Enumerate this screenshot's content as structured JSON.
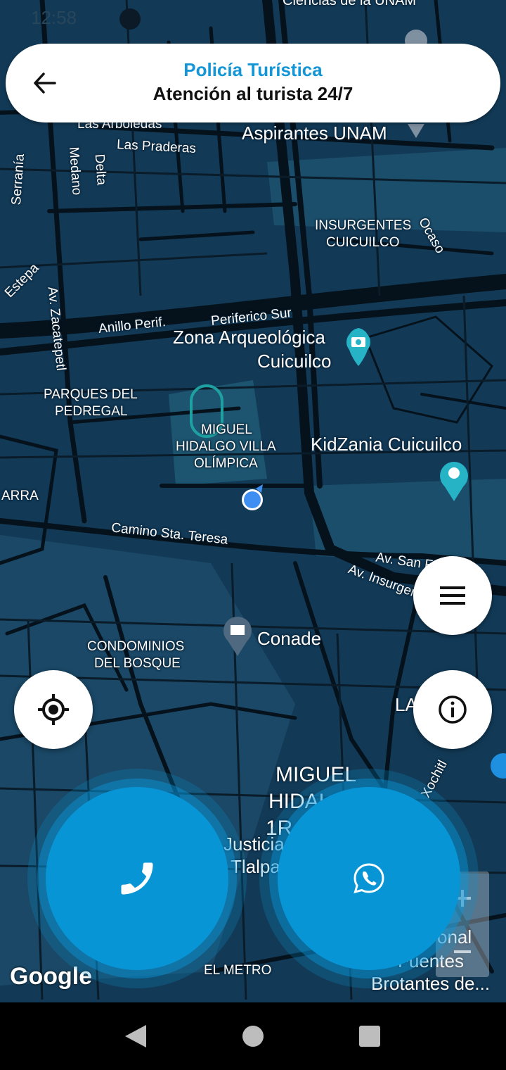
{
  "status_bar": {
    "time": "12:58"
  },
  "header": {
    "title": "Policía Turística",
    "subtitle": "Atención al turista 24/7"
  },
  "map": {
    "labels": {
      "ciencias": "Ciencias de la UNAM",
      "aspirantes": "Aspirantes UNAM",
      "arboledas": "Las Arboledas",
      "praderas": "Las Praderas",
      "serrania": "Serranía",
      "medano": "Medano",
      "delta": "Delta",
      "insurgentes_cuicuilco_1": "INSURGENTES",
      "insurgentes_cuicuilco_2": "CUICUILCO",
      "ocaso": "Ocaso",
      "estepa": "Estepa",
      "zacatepetl": "Av. Zacatepetl",
      "anillo": "Anillo Perif.",
      "periferico": "Periferico Sur",
      "zona_1": "Zona Arqueológica",
      "zona_2": "Cuicuilco",
      "parques_1": "PARQUES DEL",
      "parques_2": "PEDREGAL",
      "miguel_villa_1": "MIGUEL",
      "miguel_villa_2": "HIDALGO VILLA",
      "miguel_villa_3": "OLÍMPICA",
      "kidzania": "KidZania Cuicuilco",
      "arra": "ARRA",
      "camino": "Camino Sta. Teresa",
      "av_san": "Av. San Fernando",
      "av_insurgentes": "Av. Insurgentes",
      "conade": "Conade",
      "condominios_1": "CONDOMINIOS",
      "condominios_2": "DEL BOSQUE",
      "la": "LA",
      "miguel_1ra_1": "MIGUEL",
      "miguel_1ra_2": "HIDALGO",
      "miguel_1ra_3": "1RA",
      "xochitl": "Xochitl",
      "justicia_1": "Justicia p",
      "justicia_2": "Tlalpa",
      "el_metro": "EL METRO",
      "nal": "onal",
      "fuentes": "Fuentes",
      "brotantes": "Brotantes de..."
    },
    "google_logo": "Google"
  },
  "buttons": {
    "menu": "menu",
    "locate": "locate",
    "info": "info",
    "call": "call",
    "whatsapp": "whatsapp"
  },
  "colors": {
    "accent": "#0895d6",
    "title": "#1496d6",
    "map_bg": "#123a57",
    "road": "#05121c"
  }
}
